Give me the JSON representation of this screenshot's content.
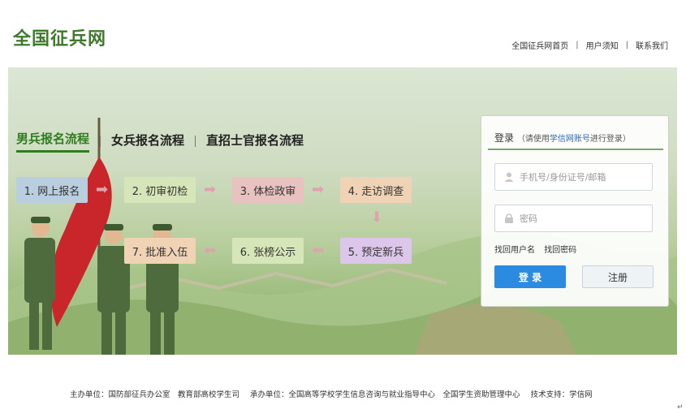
{
  "header": {
    "logo": "全国征兵网",
    "nav": [
      "全国征兵网首页",
      "用户须知",
      "联系我们"
    ]
  },
  "tabs": [
    "男兵报名流程",
    "女兵报名流程",
    "直招士官报名流程"
  ],
  "steps": [
    "1. 网上报名",
    "2. 初审初检",
    "3. 体检政审",
    "4. 走访调查",
    "5. 预定新兵",
    "6. 张榜公示",
    "7. 批准入伍"
  ],
  "login": {
    "title": "登录",
    "subtitle_pre": "（请使用",
    "subtitle_link": "学信网账号",
    "subtitle_post": "进行登录）",
    "username_placeholder": "手机号/身份证号/邮箱",
    "password_placeholder": "密码",
    "forgot_username": "找回用户名",
    "forgot_password": "找回密码",
    "login_button": "登 录",
    "register_button": "注册"
  },
  "footer": {
    "host": "主办单位：国防部征兵办公室　教育部高校学生司",
    "organizer": "承办单位：全国高等学校学生信息咨询与就业指导中心　全国学生资助管理中心",
    "tech": "技术支持：学信网"
  },
  "corner_mark": "↵",
  "colors": {
    "brand_green": "#3f7a2c",
    "active_tab": "#2e7d1e",
    "login_button": "#2b8be0",
    "step_blue": "#b9cfe0",
    "step_green": "#d7e6b8",
    "step_pink": "#e8c1c1",
    "step_orange": "#efd3b4",
    "step_purple": "#dcc6ea",
    "arrow": "#e0a2ad"
  }
}
